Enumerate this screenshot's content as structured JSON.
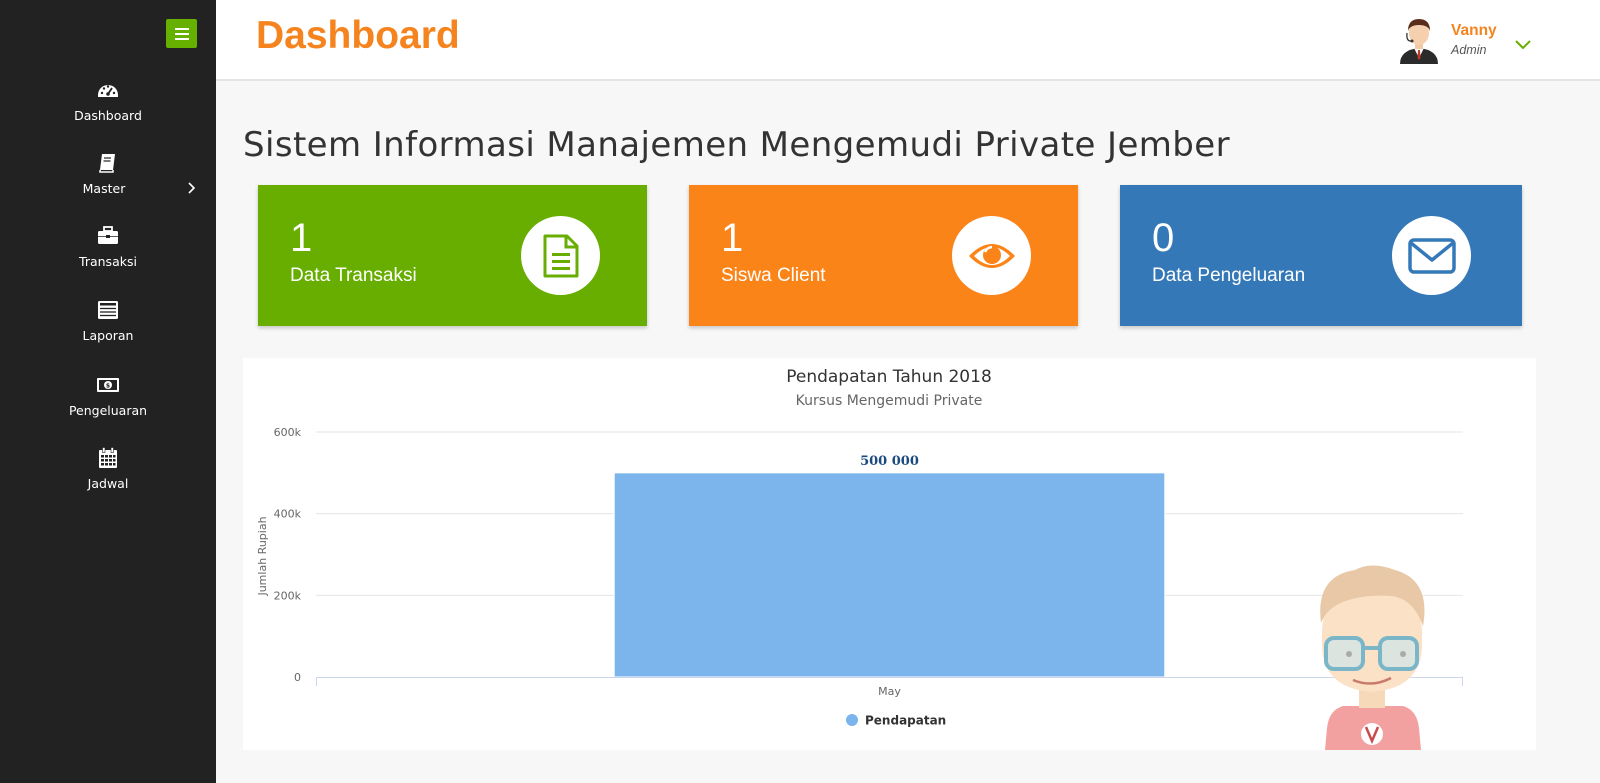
{
  "sidebar": {
    "items": [
      {
        "label": "Dashboard",
        "icon": "dashboard-gauge-icon"
      },
      {
        "label": "Master",
        "icon": "book-icon",
        "has_submenu": true
      },
      {
        "label": "Transaksi",
        "icon": "briefcase-icon"
      },
      {
        "label": "Laporan",
        "icon": "list-icon"
      },
      {
        "label": "Pengeluaran",
        "icon": "money-bill-icon"
      },
      {
        "label": "Jadwal",
        "icon": "calendar-icon"
      }
    ]
  },
  "header": {
    "title": "Dashboard",
    "user": {
      "name": "Vanny",
      "role": "Admin"
    }
  },
  "main": {
    "system_title": "Sistem Informasi Manajemen Mengemudi Private Jember",
    "cards": [
      {
        "value": "1",
        "label": "Data Transaksi",
        "color": "#67ae00",
        "icon": "file-document-icon"
      },
      {
        "value": "1",
        "label": "Siswa Client",
        "color": "#fb8419",
        "icon": "eye-icon"
      },
      {
        "value": "0",
        "label": "Data Pengeluaran",
        "color": "#3478b8",
        "icon": "envelope-icon"
      }
    ]
  },
  "colors": {
    "sidebar_bg": "#222222",
    "accent_green": "#67ae00",
    "accent_orange": "#f5841f",
    "accent_blue": "#3478b8",
    "bar_color": "#7cb5ec"
  },
  "chart_data": {
    "type": "bar",
    "title": "Pendapatan Tahun 2018",
    "subtitle": "Kursus Mengemudi Private",
    "xlabel": "",
    "ylabel": "Jumlah Rupiah",
    "categories": [
      "May"
    ],
    "series": [
      {
        "name": "Pendapatan",
        "values": [
          500000
        ],
        "color": "#7cb5ec"
      }
    ],
    "data_labels": [
      "500 000"
    ],
    "ylim": [
      0,
      600000
    ],
    "yticks": [
      0,
      200000,
      400000,
      600000
    ],
    "ytick_labels": [
      "0",
      "200k",
      "400k",
      "600k"
    ],
    "grid": true,
    "legend_position": "bottom"
  }
}
